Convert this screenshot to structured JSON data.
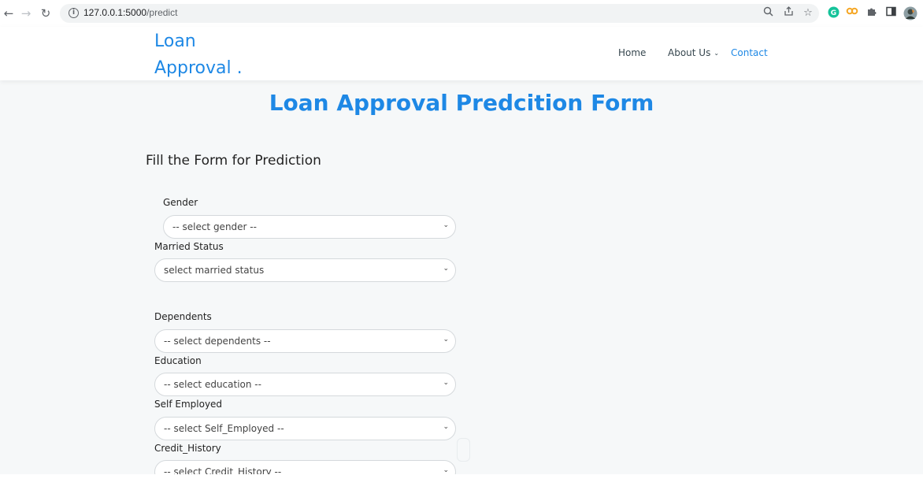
{
  "browser": {
    "url_host": "127.0.0.1:5000",
    "url_path": "/predict"
  },
  "site": {
    "logo_line1": "Loan",
    "logo_line2": "Approval .",
    "nav": [
      {
        "label": "Home"
      },
      {
        "label": "About Us"
      },
      {
        "label": "Contact"
      }
    ],
    "active_color": "#1e88e5"
  },
  "page": {
    "title": "Loan Approval Predcition Form",
    "subtitle": "Fill the Form for Prediction"
  },
  "form": {
    "fields": [
      {
        "label": "Gender",
        "value": "-- select gender --"
      },
      {
        "label": "Married Status",
        "value": "select married status"
      },
      {
        "label": "Dependents",
        "value": "-- select dependents --"
      },
      {
        "label": "Education",
        "value": "-- select education --"
      },
      {
        "label": "Self Employed",
        "value": "-- select Self_Employed --"
      },
      {
        "label": "Credit_History",
        "value": "-- select Credit_History --"
      }
    ]
  }
}
